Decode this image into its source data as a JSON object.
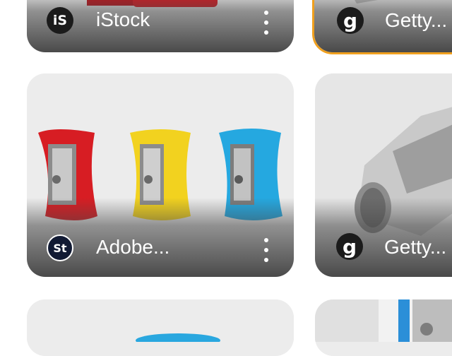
{
  "results": [
    {
      "source": "iStock",
      "logo_text": "iS",
      "image": "red-pencil-sharpener-icon",
      "selected": false
    },
    {
      "source": "Getty...",
      "logo_text": "g",
      "image": "metal-pencil-sharpener-icon",
      "selected": true
    },
    {
      "source": "Adobe...",
      "logo_text": "St",
      "image": "three-color-pencil-sharpeners-icon",
      "selected": false
    },
    {
      "source": "Getty...",
      "logo_text": "g",
      "image": "metal-pencil-sharpener-closeup-icon",
      "selected": false
    }
  ],
  "colors": {
    "selected_border": "#f0a01e",
    "card_bg": "#ececec"
  }
}
